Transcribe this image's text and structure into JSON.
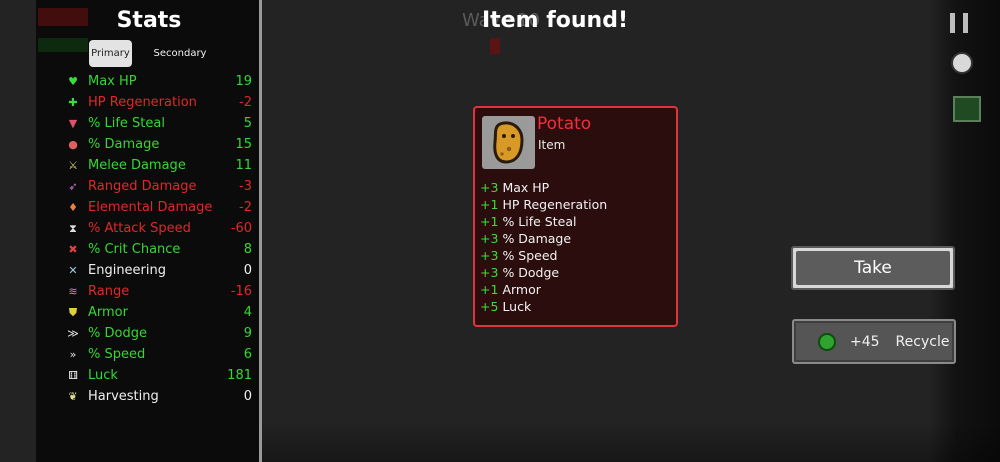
{
  "stats_panel": {
    "title": "Stats",
    "tabs": {
      "primary": "Primary",
      "secondary": "Secondary"
    },
    "stats": [
      {
        "label": "Max HP",
        "value": "19",
        "color": "#36d636",
        "icon": "heart-icon",
        "glyph": "♥",
        "icon_color": "#3ddc3d"
      },
      {
        "label": "HP Regeneration",
        "value": "-2",
        "color": "#e02828",
        "icon": "regen-icon",
        "glyph": "✚",
        "icon_color": "#3ddc3d"
      },
      {
        "label": "% Life Steal",
        "value": "5",
        "color": "#36d636",
        "icon": "fang-icon",
        "glyph": "▼",
        "icon_color": "#e05070"
      },
      {
        "label": "% Damage",
        "value": "15",
        "color": "#36d636",
        "icon": "muscle-icon",
        "glyph": "●",
        "icon_color": "#e06060"
      },
      {
        "label": "Melee Damage",
        "value": "11",
        "color": "#36d636",
        "icon": "sword-icon",
        "glyph": "⚔",
        "icon_color": "#d8d070"
      },
      {
        "label": "Ranged Damage",
        "value": "-3",
        "color": "#e02828",
        "icon": "bow-icon",
        "glyph": "➶",
        "icon_color": "#d070d0"
      },
      {
        "label": "Elemental Damage",
        "value": "-2",
        "color": "#e02828",
        "icon": "flame-icon",
        "glyph": "♦",
        "icon_color": "#f08040"
      },
      {
        "label": "% Attack Speed",
        "value": "-60",
        "color": "#e02828",
        "icon": "hourglass-icon",
        "glyph": "⧗",
        "icon_color": "#e0e0e0"
      },
      {
        "label": "% Crit Chance",
        "value": "8",
        "color": "#36d636",
        "icon": "crit-icon",
        "glyph": "✖",
        "icon_color": "#e04040"
      },
      {
        "label": "Engineering",
        "value": "0",
        "color": "#f0f0f0",
        "icon": "wrench-icon",
        "glyph": "✕",
        "icon_color": "#a0d0e0"
      },
      {
        "label": "Range",
        "value": "-16",
        "color": "#e02828",
        "icon": "range-icon",
        "glyph": "≋",
        "icon_color": "#c080e0"
      },
      {
        "label": "Armor",
        "value": "4",
        "color": "#36d636",
        "icon": "shield-icon",
        "glyph": "⛊",
        "icon_color": "#e0d040"
      },
      {
        "label": "% Dodge",
        "value": "9",
        "color": "#36d636",
        "icon": "dodge-icon",
        "glyph": "≫",
        "icon_color": "#e0e0e0"
      },
      {
        "label": "% Speed",
        "value": "6",
        "color": "#36d636",
        "icon": "speed-icon",
        "glyph": "»",
        "icon_color": "#e0e0e0"
      },
      {
        "label": "Luck",
        "value": "181",
        "color": "#36d636",
        "icon": "dice-icon",
        "glyph": "⚅",
        "icon_color": "#f0f0f0"
      },
      {
        "label": "Harvesting",
        "value": "0",
        "color": "#f0f0f0",
        "icon": "harvest-icon",
        "glyph": "❦",
        "icon_color": "#e0e090"
      }
    ]
  },
  "center": {
    "title": "Item found!",
    "wave_text": "Wave 10",
    "item": {
      "name": "Potato",
      "type": "Item",
      "name_color": "#f0303a",
      "icon": "potato-icon",
      "effects": [
        {
          "amount": "+3",
          "label": "Max HP"
        },
        {
          "amount": "+1",
          "label": "HP Regeneration"
        },
        {
          "amount": "+1",
          "label": "% Life Steal"
        },
        {
          "amount": "+3",
          "label": "% Damage"
        },
        {
          "amount": "+3",
          "label": "% Speed"
        },
        {
          "amount": "+3",
          "label": "% Dodge"
        },
        {
          "amount": "+1",
          "label": "Armor"
        },
        {
          "amount": "+5",
          "label": "Luck"
        }
      ]
    }
  },
  "actions": {
    "take_label": "Take",
    "recycle_amount": "+45",
    "recycle_label": "Recycle"
  },
  "colors": {
    "positive": "#36d636",
    "negative": "#e02828",
    "rarity_border": "#e0343c"
  }
}
